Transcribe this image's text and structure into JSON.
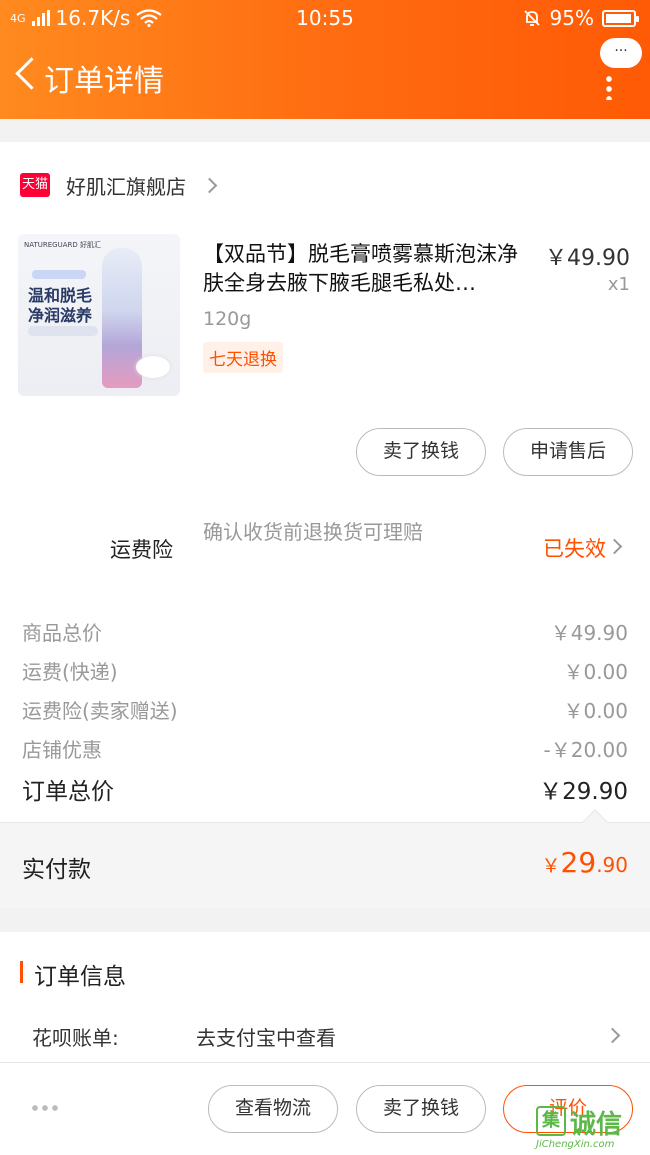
{
  "status_bar": {
    "network": "4G",
    "speed": "16.7K/s",
    "time": "10:55",
    "battery": "95%",
    "battery_level": 0.95
  },
  "header": {
    "title": "订单详情",
    "more_label": "···"
  },
  "store": {
    "badge": "天猫",
    "name": "好肌汇旗舰店"
  },
  "product": {
    "image": {
      "brand": "NATUREGUARD 好肌汇",
      "line1": "温和脱毛",
      "line2": "净润滋养"
    },
    "title": "【双品节】脱毛膏喷雾慕斯泡沫净肤全身去腋下腋毛腿毛私处…",
    "price": "￥49.90",
    "quantity": "x1",
    "spec": "120g",
    "badge": "七天退换"
  },
  "product_actions": {
    "sell": "卖了换钱",
    "after_sale": "申请售后"
  },
  "insurance": {
    "label": "运费险",
    "desc": "确认收货前退换货可理赔",
    "status": "已失效"
  },
  "fees": [
    {
      "label": "商品总价",
      "value": "￥49.90"
    },
    {
      "label": "运费(快递)",
      "value": "￥0.00"
    },
    {
      "label": "运费险(卖家赠送)",
      "value": "￥0.00"
    },
    {
      "label": "店铺优惠",
      "value": "-￥20.00"
    }
  ],
  "total": {
    "label": "订单总价",
    "value": "￥29.90"
  },
  "paid": {
    "label": "实付款",
    "currency": "￥",
    "integer": "29",
    "decimal": ".90"
  },
  "order_info": {
    "title": "订单信息",
    "huabei_key": "花呗账单:",
    "huabei_value": "去支付宝中查看"
  },
  "bottom_bar": {
    "logistics": "查看物流",
    "sell": "卖了换钱",
    "review": "评价"
  },
  "watermark": {
    "mark": "集",
    "text": "诚信",
    "url": "JiChengXin.com"
  },
  "colors": {
    "accent": "#ff5000",
    "header_start": "#ff8a1f",
    "header_end": "#ff5a05",
    "tmall": "#ff0036"
  }
}
